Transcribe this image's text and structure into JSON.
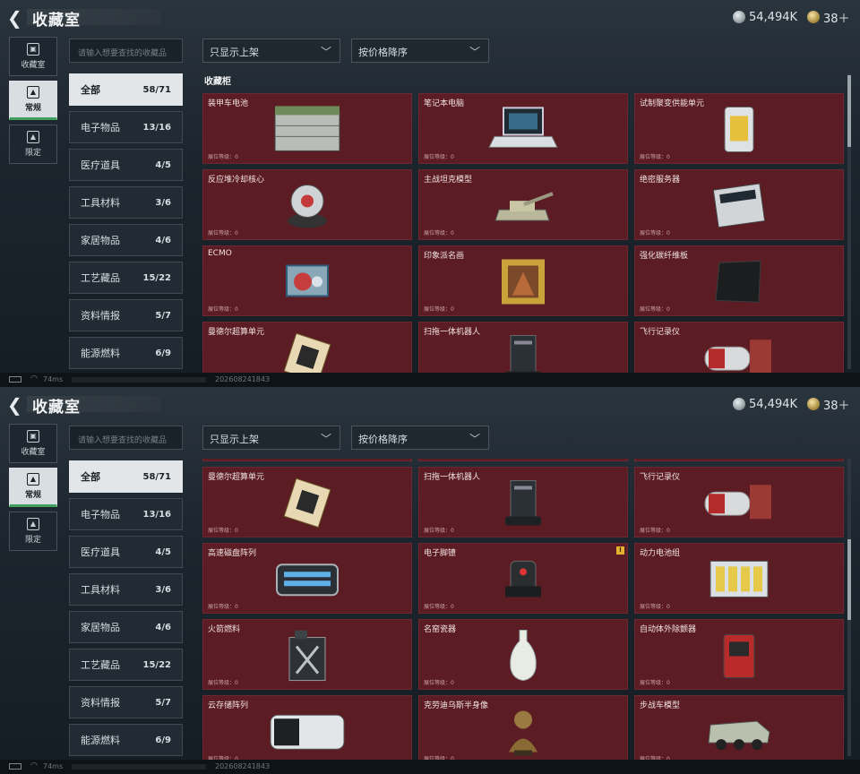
{
  "header": {
    "title": "收藏室",
    "silver": "54,494K",
    "gold": "38＋"
  },
  "status": {
    "ping": "74ms",
    "stamp": "20260824184З"
  },
  "nav": [
    {
      "label": "收藏室"
    },
    {
      "label": "常规"
    },
    {
      "label": "限定"
    }
  ],
  "search": {
    "placeholder": "请输入想要查找的收藏品"
  },
  "filters": {
    "shelf": "只显示上架",
    "sort": "按价格降序"
  },
  "categories": [
    {
      "label": "全部",
      "count": "58/71"
    },
    {
      "label": "电子物品",
      "count": "13/16"
    },
    {
      "label": "医疗道具",
      "count": "4/5"
    },
    {
      "label": "工具材料",
      "count": "3/6"
    },
    {
      "label": "家居物品",
      "count": "4/6"
    },
    {
      "label": "工艺藏品",
      "count": "15/22"
    },
    {
      "label": "资料情报",
      "count": "5/7"
    },
    {
      "label": "能源燃料",
      "count": "6/9"
    }
  ],
  "section_title": "收藏柜",
  "level_label": "展位等级：0",
  "top_items": [
    {
      "name": "装甲车电池",
      "icon": "battery"
    },
    {
      "name": "笔记本电脑",
      "icon": "laptop"
    },
    {
      "name": "试制聚变供能单元",
      "icon": "fusion-cell"
    },
    {
      "name": "反应堆冷却核心",
      "icon": "reactor-core"
    },
    {
      "name": "主战坦克模型",
      "icon": "tank"
    },
    {
      "name": "绝密服务器",
      "icon": "server"
    },
    {
      "name": "ECMO",
      "icon": "ecmo"
    },
    {
      "name": "印象派名画",
      "icon": "painting"
    },
    {
      "name": "强化碳纤维板",
      "icon": "carbon-plate"
    },
    {
      "name": "曼德尔超算单元",
      "icon": "cpu"
    },
    {
      "name": "扫拖一体机器人",
      "icon": "robot"
    },
    {
      "name": "飞行记录仪",
      "icon": "flight-recorder"
    }
  ],
  "bottom_items": [
    {
      "name": "",
      "icon": "partial"
    },
    {
      "name": "",
      "icon": "partial"
    },
    {
      "name": "",
      "icon": "partial"
    },
    {
      "name": "曼德尔超算单元",
      "icon": "cpu"
    },
    {
      "name": "扫拖一体机器人",
      "icon": "robot"
    },
    {
      "name": "飞行记录仪",
      "icon": "flight-recorder"
    },
    {
      "name": "高速磁盘阵列",
      "icon": "disk-array"
    },
    {
      "name": "电子脚镣",
      "icon": "ankle-monitor",
      "warn": "!"
    },
    {
      "name": "动力电池组",
      "icon": "battery-pack"
    },
    {
      "name": "火箭燃料",
      "icon": "fuel-can"
    },
    {
      "name": "名窑瓷器",
      "icon": "vase"
    },
    {
      "name": "自动体外除颤器",
      "icon": "aed"
    },
    {
      "name": "云存储阵列",
      "icon": "cloud-storage"
    },
    {
      "name": "克劳迪乌斯半身像",
      "icon": "bust"
    },
    {
      "name": "步战车模型",
      "icon": "ifv"
    }
  ],
  "colors": {
    "tile_bg": "#5b1c24",
    "accent_green": "#3fa05d"
  }
}
